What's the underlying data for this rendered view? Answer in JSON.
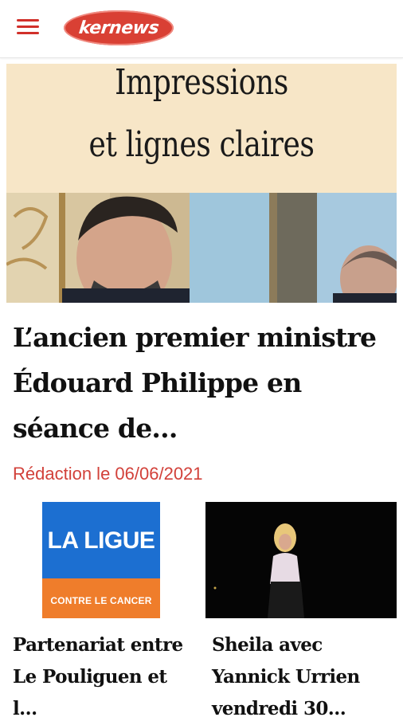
{
  "header": {
    "logo_text": "kernews",
    "menu_icon": "hamburger-menu-icon",
    "accent_color": "#d1302a"
  },
  "hero": {
    "banner_line1": "Impressions",
    "banner_line2": "et lignes claires",
    "headline": "L’ancien premier ministre Édouard Philippe en séance de…",
    "byline": "Rédaction le 06/06/2021"
  },
  "cards": [
    {
      "logo_text": "LA LIGUE",
      "logo_subtext": "CONTRE LE CANCER",
      "title": "Partenariat entre Le Pouliguen et l…"
    },
    {
      "title": "Sheila avec Yannick Urrien vendredi 30…"
    }
  ]
}
